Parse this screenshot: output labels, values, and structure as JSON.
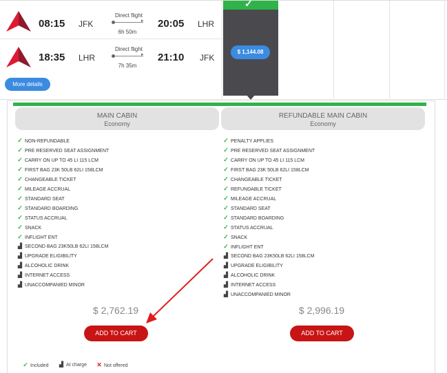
{
  "flights": {
    "outbound": {
      "dep_time": "08:15",
      "dep_airport": "JFK",
      "type": "Direct flight",
      "duration": "6h 50m",
      "arr_time": "20:05",
      "arr_airport": "LHR"
    },
    "return": {
      "dep_time": "18:35",
      "dep_airport": "LHR",
      "type": "Direct flight",
      "duration": "7h 35m",
      "arr_time": "21:10",
      "arr_airport": "JFK"
    },
    "more_details": "More details",
    "selected_price": "$ 1,144.08"
  },
  "fares": [
    {
      "name": "MAIN CABIN",
      "cabin": "Economy",
      "features": [
        {
          "icon": "check",
          "text": "NON-REFUNDABLE"
        },
        {
          "icon": "check",
          "text": "PRE RESERVED SEAT ASSIGNMENT"
        },
        {
          "icon": "check",
          "text": "CARRY ON UP TO 45 LI 115 LCM"
        },
        {
          "icon": "check",
          "text": "FIRST BAG 23K 50LB 62LI 158LCM"
        },
        {
          "icon": "check",
          "text": "CHANGEABLE TICKET"
        },
        {
          "icon": "check",
          "text": "MILEAGE ACCRUAL"
        },
        {
          "icon": "check",
          "text": "STANDARD SEAT"
        },
        {
          "icon": "check",
          "text": "STANDARD BOARDING"
        },
        {
          "icon": "check",
          "text": "STATUS ACCRUAL"
        },
        {
          "icon": "check",
          "text": "SNACK"
        },
        {
          "icon": "check",
          "text": "INFLIGHT ENT"
        },
        {
          "icon": "charge",
          "text": "SECOND BAG 23K50LB 62LI 158LCM"
        },
        {
          "icon": "charge",
          "text": "UPGRADE ELIGIBILITY"
        },
        {
          "icon": "charge",
          "text": "ALCOHOLIC DRINK"
        },
        {
          "icon": "charge",
          "text": "INTERNET ACCESS"
        },
        {
          "icon": "charge",
          "text": "UNACCOMPANIED MINOR"
        }
      ],
      "price": "$ 2,762.19",
      "cta": "ADD TO CART"
    },
    {
      "name": "REFUNDABLE MAIN CABIN",
      "cabin": "Economy",
      "features": [
        {
          "icon": "check",
          "text": "PENALTY APPLIES"
        },
        {
          "icon": "check",
          "text": "PRE RESERVED SEAT ASSIGNMENT"
        },
        {
          "icon": "check",
          "text": "CARRY ON UP TO 45 LI 115 LCM"
        },
        {
          "icon": "check",
          "text": "FIRST BAG 23K 50LB 62LI 158LCM"
        },
        {
          "icon": "check",
          "text": "CHANGEABLE TICKET"
        },
        {
          "icon": "check",
          "text": "REFUNDABLE TICKET"
        },
        {
          "icon": "check",
          "text": "MILEAGE ACCRUAL"
        },
        {
          "icon": "check",
          "text": "STANDARD SEAT"
        },
        {
          "icon": "check",
          "text": "STANDARD BOARDING"
        },
        {
          "icon": "check",
          "text": "STATUS ACCRUAL"
        },
        {
          "icon": "check",
          "text": "SNACK"
        },
        {
          "icon": "check",
          "text": "INFLIGHT ENT"
        },
        {
          "icon": "charge",
          "text": "SECOND BAG 23K50LB 62LI 158LCM"
        },
        {
          "icon": "charge",
          "text": "UPGRADE ELIGIBILITY"
        },
        {
          "icon": "charge",
          "text": "ALCOHOLIC DRINK"
        },
        {
          "icon": "charge",
          "text": "INTERNET ACCESS"
        },
        {
          "icon": "charge",
          "text": "UNACCOMPANIED MINOR"
        }
      ],
      "price": "$ 2,996.19",
      "cta": "ADD TO CART"
    }
  ],
  "legend": {
    "included": "Included",
    "charge": "At charge",
    "not_offered": "Not offered"
  },
  "colors": {
    "accent_green": "#2fb34a",
    "button_blue": "#3b8be0",
    "cart_red": "#c81414",
    "selected_dark": "#4a4a4e",
    "arrow_red": "#e21b1b"
  }
}
